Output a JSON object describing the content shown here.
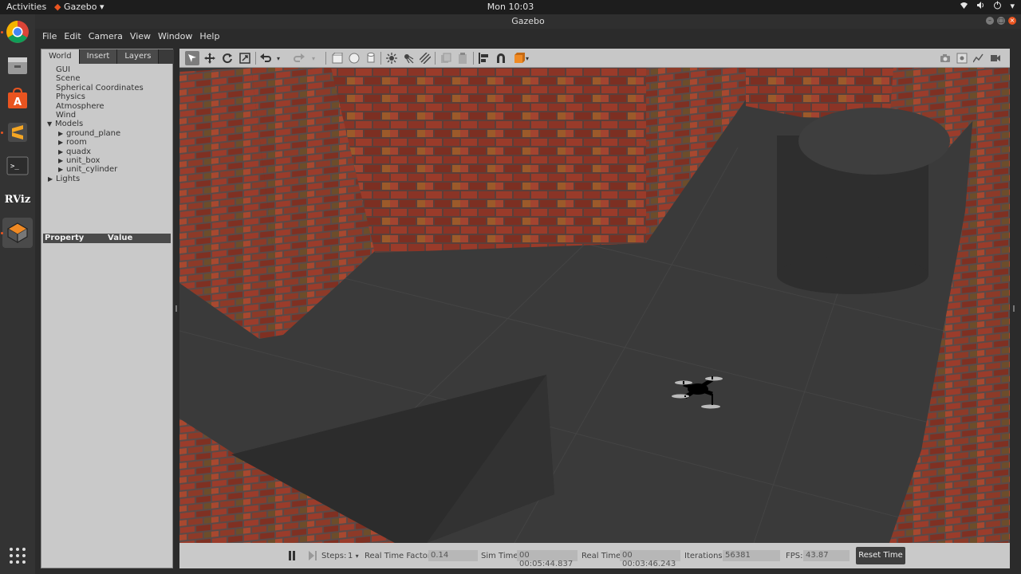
{
  "topbar": {
    "activities": "Activities",
    "app_menu": "Gazebo",
    "clock": "Mon 10:03"
  },
  "window": {
    "title": "Gazebo"
  },
  "dock": {
    "items": [
      "chrome",
      "files",
      "software-center",
      "sublime-text",
      "terminal",
      "rviz",
      "gazebo",
      "show-applications"
    ],
    "rviz_label": "RViz"
  },
  "menubar": [
    "File",
    "Edit",
    "Camera",
    "View",
    "Window",
    "Help"
  ],
  "left_panel": {
    "tabs": [
      "World",
      "Insert",
      "Layers"
    ],
    "tree": {
      "gui": "GUI",
      "scene": "Scene",
      "spherical": "Spherical Coordinates",
      "physics": "Physics",
      "atmosphere": "Atmosphere",
      "wind": "Wind",
      "models": "Models",
      "model_items": [
        "ground_plane",
        "room",
        "quadx",
        "unit_box",
        "unit_cylinder"
      ],
      "lights": "Lights"
    },
    "property_header": {
      "property": "Property",
      "value": "Value"
    }
  },
  "bottom": {
    "steps_label": "Steps:",
    "steps_value": "1",
    "rtf_label": "Real Time Factor:",
    "rtf_value": "0.14",
    "sim_time_label": "Sim Time:",
    "sim_time_value": "00 00:05:44.837",
    "real_time_label": "Real Time:",
    "real_time_value": "00 00:03:46.243",
    "iterations_label": "Iterations:",
    "iterations_value": "56381",
    "fps_label": "FPS:",
    "fps_value": "43.87",
    "reset_label": "Reset Time"
  },
  "colors": {
    "accent": "#e95420",
    "brick": "#8a3a2a",
    "floor": "#3b3b3b"
  }
}
